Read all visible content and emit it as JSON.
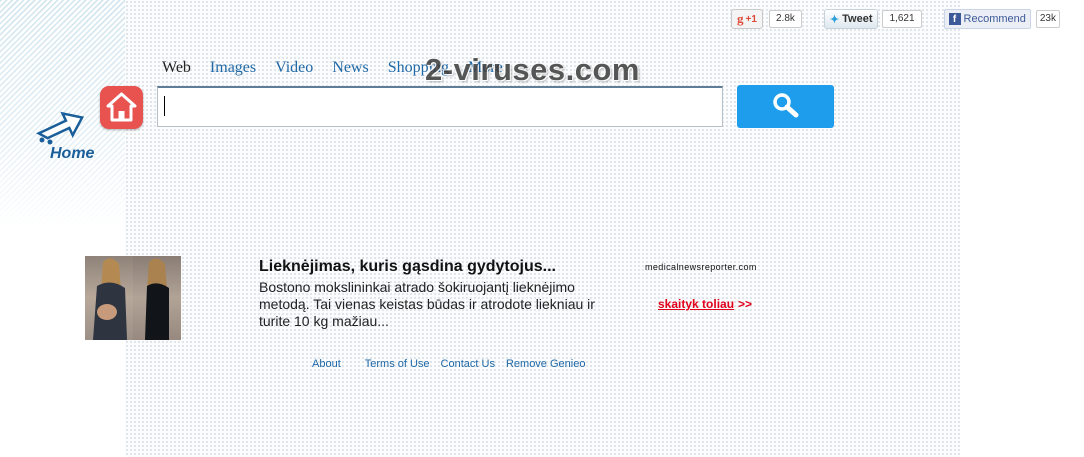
{
  "share": {
    "gplus_label": "+1",
    "gplus_count": "2.8k",
    "tweet_label": "Tweet",
    "tweet_count": "1,621",
    "fb_label": "Recommend",
    "fb_count": "23k"
  },
  "logo": {
    "home_label": "Home"
  },
  "watermark": "2-viruses.com",
  "tabs": [
    {
      "label": "Web",
      "active": true
    },
    {
      "label": "Images"
    },
    {
      "label": "Video"
    },
    {
      "label": "News"
    },
    {
      "label": "Shopping"
    },
    {
      "label": "More"
    }
  ],
  "search": {
    "value": "",
    "placeholder": "",
    "button_icon": "magnifier-icon"
  },
  "ad": {
    "title": "Lieknėjimas, kuris gąsdina gydytojus...",
    "description": "Bostono mokslininkai atrado šokiruojantį lieknėjimo metodą. Tai vienas keistas būdas ir atrodote liekniau ir turite 10 kg mažiau...",
    "source": "medicalnewsreporter.com",
    "read_more": "skaityk toliau",
    "read_more_arrows": ">>"
  },
  "footer": {
    "about": "About",
    "terms": "Terms of Use",
    "contact": "Contact Us",
    "remove": "Remove Genieo"
  },
  "colors": {
    "accent_blue": "#1e9ded",
    "link_blue": "#1f69a8",
    "home_red": "#e8524f",
    "readmore_red": "#e2001a"
  }
}
